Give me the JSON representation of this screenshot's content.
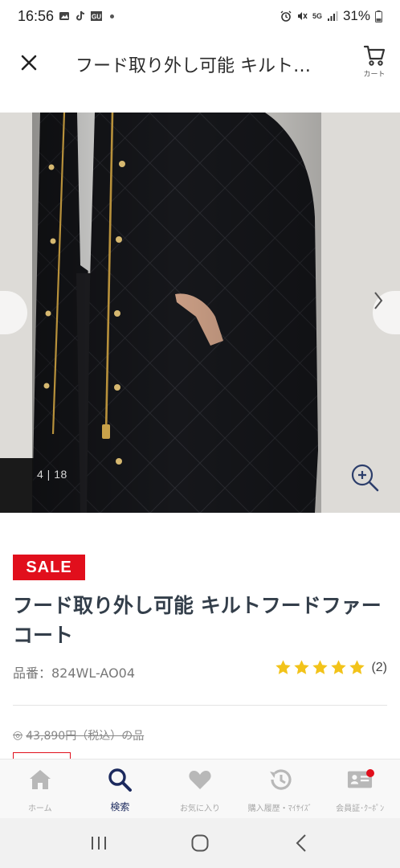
{
  "status_bar": {
    "time": "16:56",
    "battery": "31%",
    "network": "5G"
  },
  "header": {
    "title": "フード取り外し可能 キルト…",
    "cart_label": "カート"
  },
  "gallery": {
    "counter": "4 | 18",
    "current_index": 4,
    "total_images": 18
  },
  "product": {
    "sale_label": "SALE",
    "name": "フード取り外し可能 キルトフードファーコート",
    "code": "品番：824WL-AO04",
    "rating_stars": 5,
    "review_count": "(2)",
    "old_price": "43,890円（税込）の品",
    "old_price_prefix": "◎"
  },
  "bottom_nav": {
    "items": [
      {
        "label": "ホーム",
        "icon": "home-icon",
        "active": false
      },
      {
        "label": "検索",
        "icon": "search-icon",
        "active": true
      },
      {
        "label": "お気に入り",
        "icon": "heart-icon",
        "active": false
      },
      {
        "label": "購入履歴・ﾏｲｻｲｽﾞ",
        "icon": "history-icon",
        "active": false
      },
      {
        "label": "会員証･ｸｰﾎﾟﾝ",
        "icon": "member-card-icon",
        "active": false
      }
    ]
  },
  "colors": {
    "sale_red": "#e10f1c",
    "active_navy": "#1c2a5e",
    "star_yellow": "#f2c31a",
    "title_text": "#333e4a"
  }
}
